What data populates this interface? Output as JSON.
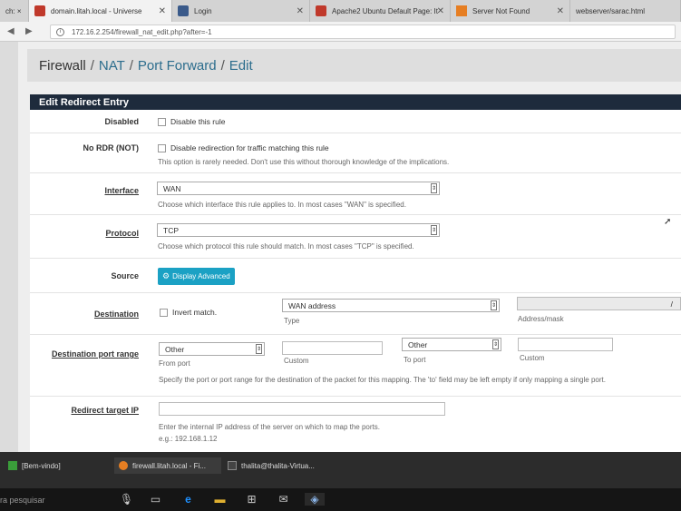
{
  "browser": {
    "tabs": [
      {
        "label": "ch: ×",
        "color": "#666666"
      },
      {
        "label": "domain.litah.local - Universe",
        "color": "#c0392b"
      },
      {
        "label": "Login",
        "color": "#3a5a8a"
      },
      {
        "label": "Apache2 Ubuntu Default Page: It",
        "color": "#c0392b"
      },
      {
        "label": "Server Not Found",
        "color": "#e67e22"
      },
      {
        "label": "webserver/sarac.html",
        "color": "#999999"
      }
    ],
    "url": "172.16.2.254/firewall_nat_edit.php?after=-1"
  },
  "breadcrumb": {
    "root": "Firewall",
    "nat": "NAT",
    "port_forward": "Port Forward",
    "current": "Edit",
    "separator": "/"
  },
  "panel": {
    "title": "Edit Redirect Entry"
  },
  "form": {
    "disabled": {
      "label": "Disabled",
      "checkbox_label": "Disable this rule"
    },
    "no_rdr": {
      "label": "No RDR (NOT)",
      "checkbox_label": "Disable redirection for traffic matching this rule",
      "help": "This option is rarely needed. Don't use this without thorough knowledge of the implications."
    },
    "interface": {
      "label": "Interface",
      "value": "WAN",
      "help": "Choose which interface this rule applies to. In most cases \"WAN\" is specified."
    },
    "protocol": {
      "label": "Protocol",
      "value": "TCP",
      "help": "Choose which protocol this rule should match. In most cases \"TCP\" is specified."
    },
    "source": {
      "label": "Source",
      "button": "Display Advanced"
    },
    "destination": {
      "label": "Destination",
      "invert_label": "Invert match.",
      "type_value": "WAN address",
      "type_caption": "Type",
      "mask_caption": "Address/mask",
      "mask_value": "/"
    },
    "dest_port": {
      "label": "Destination port range",
      "from_value": "Other",
      "from_caption": "From port",
      "custom1_caption": "Custom",
      "to_value": "Other",
      "to_caption": "To port",
      "custom2_caption": "Custom",
      "help": "Specify the port or port range for the destination of the packet for this mapping. The 'to' field may be left empty if only mapping a single port."
    },
    "redirect_ip": {
      "label": "Redirect target IP",
      "help": "Enter the internal IP address of the server on which to map the ports.",
      "example": "e.g.: 192.168.1.12"
    }
  },
  "taskbar": {
    "tasks": [
      {
        "label": "[Bem-vindo]",
        "color": "#3a9d3a"
      },
      {
        "label": "firewall.litah.local - Fi...",
        "color": "#e67e22"
      },
      {
        "label": "thalita@thalita-Virtua...",
        "color": "#444444"
      }
    ],
    "search": "ra pesquisar"
  }
}
